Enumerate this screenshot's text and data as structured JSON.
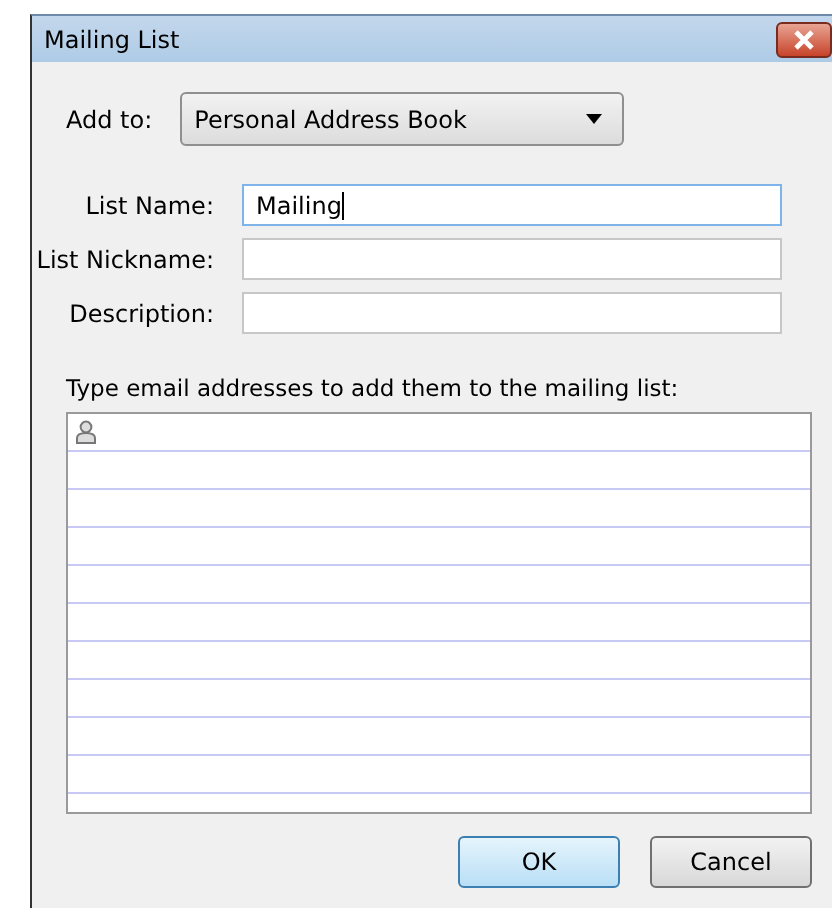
{
  "window": {
    "title": "Mailing List"
  },
  "add_to": {
    "label": "Add to:",
    "value": "Personal Address Book"
  },
  "fields": [
    {
      "label": "List Name:",
      "value": "Mailing",
      "focused": true
    },
    {
      "label": "List Nickname:",
      "focused": false
    },
    {
      "label": "Description:",
      "focused": false
    }
  ],
  "instruction": "Type email addresses to add them to the mailing list:",
  "buttons": [
    {
      "label": "OK",
      "default": true
    },
    {
      "label": "Cancel",
      "default": false
    }
  ]
}
